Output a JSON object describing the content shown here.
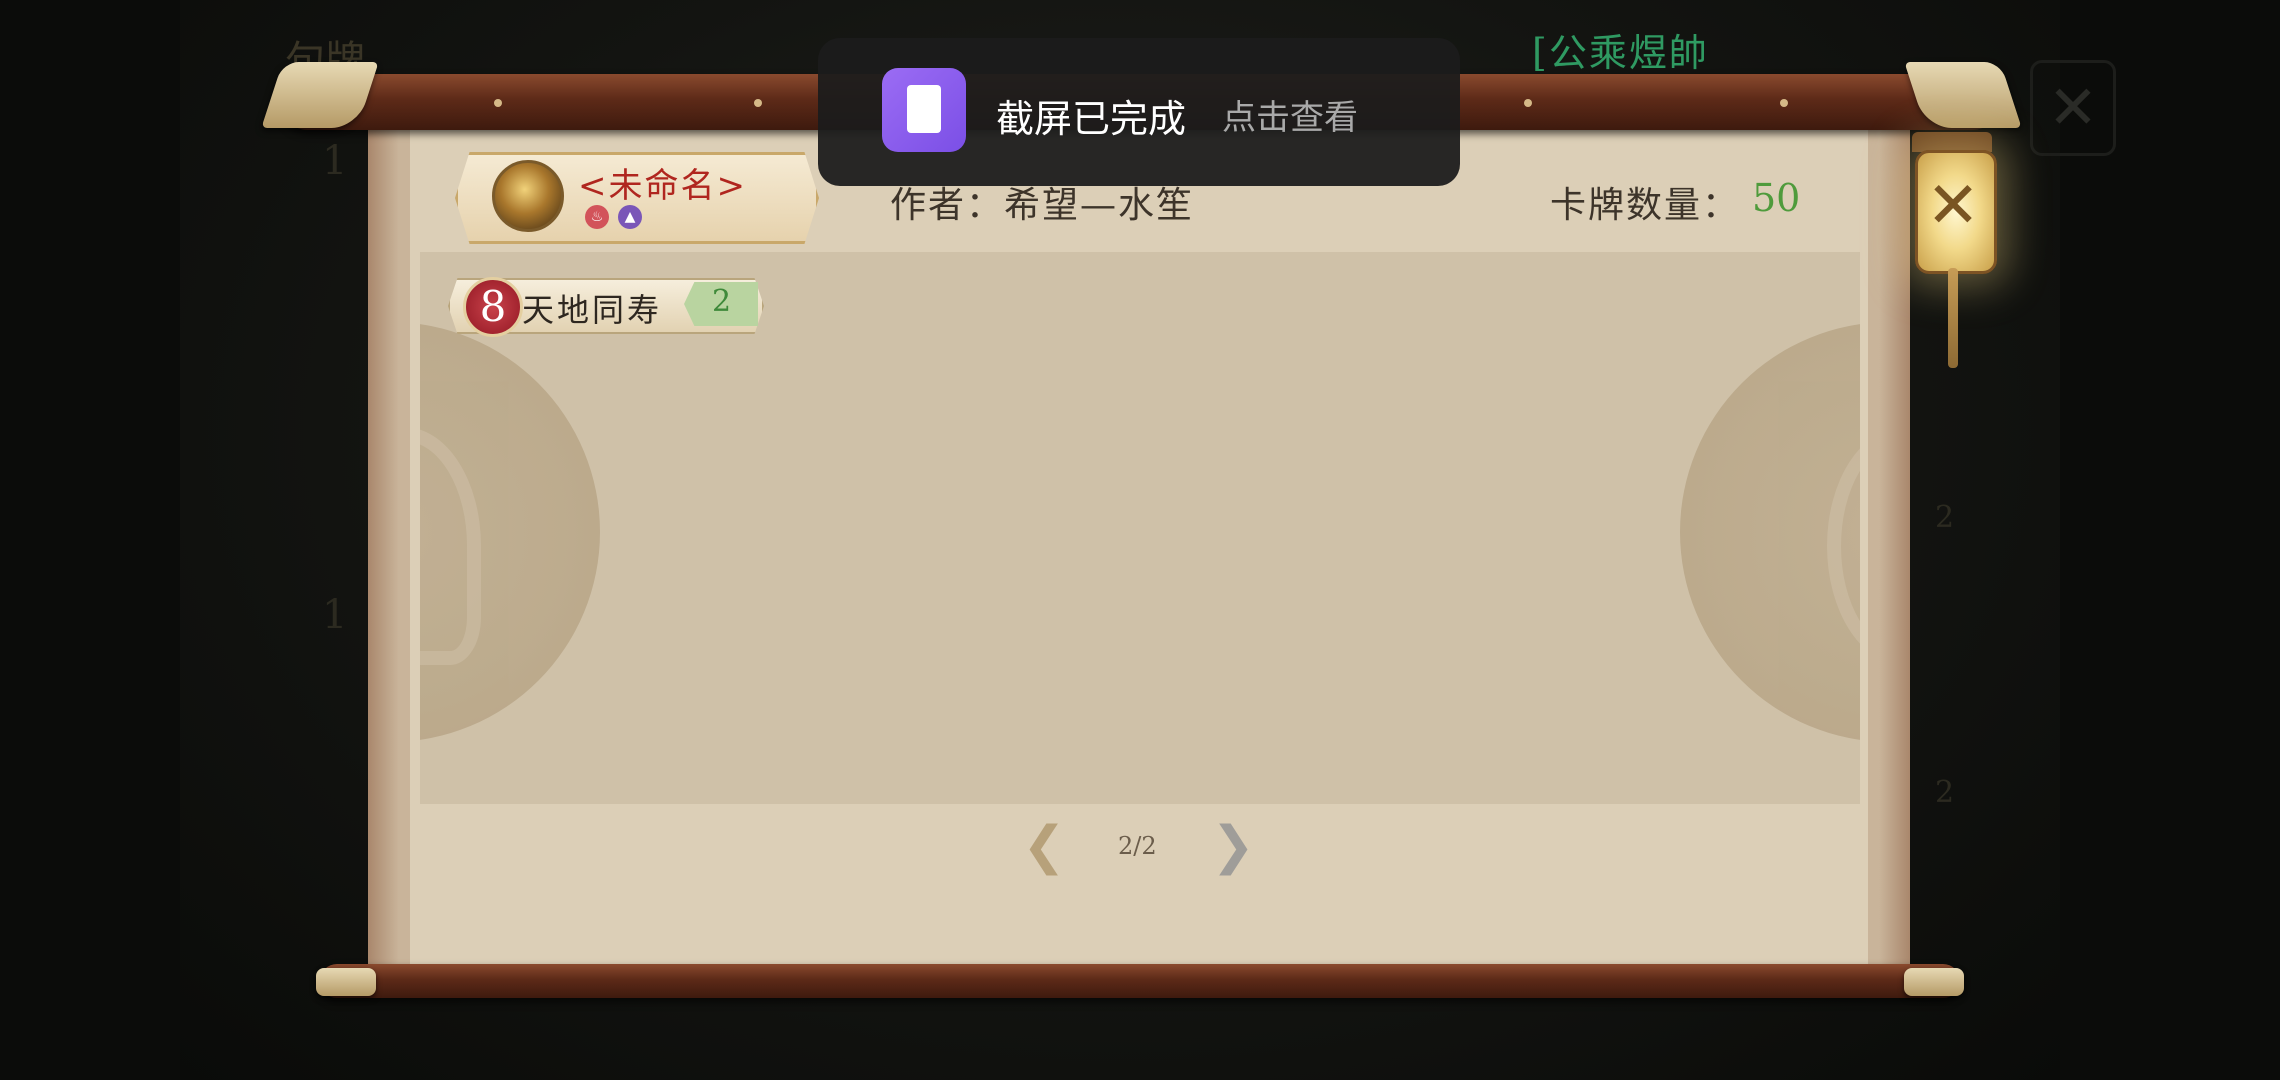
{
  "background": {
    "title": "句牌",
    "player_name": "[公乘煜帥",
    "numbers": [
      "1",
      "1",
      "2",
      "2"
    ]
  },
  "toast": {
    "title": "截屏已完成",
    "action": "点击查看"
  },
  "deck": {
    "name": "<未命名>",
    "elements": [
      "fire-icon",
      "mountain-icon"
    ],
    "author_label": "作者：",
    "author": "希望—水笙",
    "count_label": "卡牌数量：",
    "count": "50"
  },
  "cards": [
    {
      "cost": "8",
      "name": "天地同寿",
      "qty": "2"
    }
  ],
  "pagination": {
    "indicator": "2/2",
    "prev_icon": "prev-arrow-icon",
    "next_icon": "next-arrow-icon"
  },
  "close": {
    "glyph": "✕"
  }
}
